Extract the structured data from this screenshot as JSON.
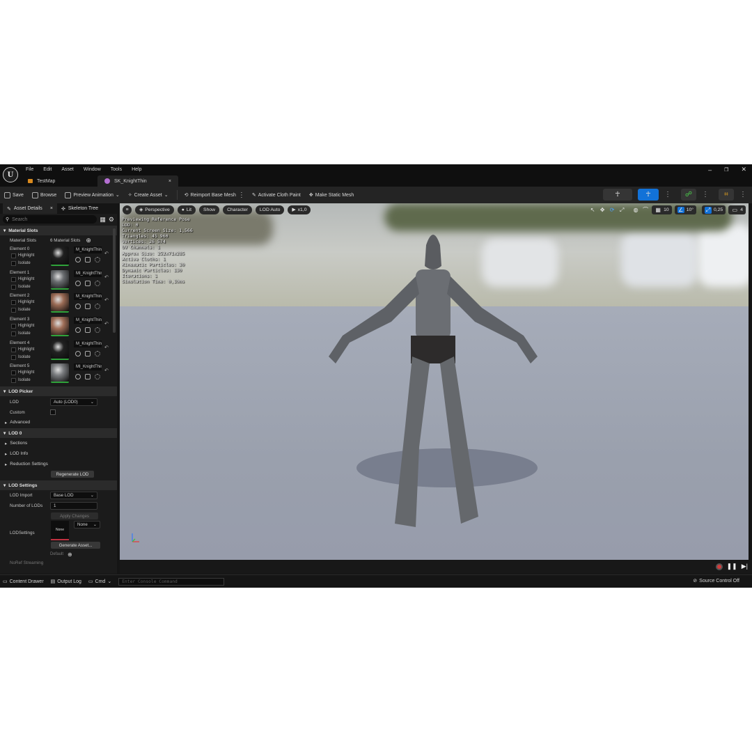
{
  "app": {
    "logo_letter": "U",
    "menu": [
      "File",
      "Edit",
      "Asset",
      "Window",
      "Tools",
      "Help"
    ],
    "tabs": [
      {
        "label": "TestMap",
        "active": false
      },
      {
        "label": "SK_KnightThin",
        "active": true
      }
    ],
    "window_controls": [
      "–",
      "❐",
      "✕"
    ]
  },
  "toolbar": {
    "save": "Save",
    "browse": "Browse",
    "preview_animation": "Preview Animation",
    "create_asset": "Create Asset",
    "reimport": "Reimport Base Mesh",
    "activate_cloth": "Activate Cloth Paint",
    "make_static": "Make Static Mesh"
  },
  "left_panel": {
    "tabs": [
      "Asset Details",
      "Skeleton Tree"
    ],
    "close_glyph": "×",
    "search_placeholder": "Search",
    "material_slots": {
      "header": "Material Slots",
      "label": "Material Slots",
      "count": "6 Material Slots",
      "highlight": "Highlight",
      "isolate": "Isolate",
      "elements": [
        {
          "name": "Element 0",
          "material": "M_KnightThin",
          "thumb": "#202020"
        },
        {
          "name": "Element 1",
          "material": "MI_KnightThin",
          "thumb": "#6a6d70"
        },
        {
          "name": "Element 2",
          "material": "M_KnightThin",
          "thumb": "#9a6b55"
        },
        {
          "name": "Element 3",
          "material": "M_KnightThin",
          "thumb": "#a06e58"
        },
        {
          "name": "Element 4",
          "material": "M_KnightThin",
          "thumb": "#222222"
        },
        {
          "name": "Element 5",
          "material": "MI_KnightThin",
          "thumb": "#7a7c7f"
        }
      ]
    },
    "lod_picker": {
      "header": "LOD Picker",
      "lod_label": "LOD",
      "lod_value": "Auto (LOD0)",
      "custom_label": "Custom",
      "advanced": "Advanced"
    },
    "lod0": {
      "header": "LOD 0",
      "sections": "Sections",
      "lod_info": "LOD Info",
      "reduction": "Reduction Settings",
      "regenerate": "Regenerate LOD"
    },
    "lod_settings": {
      "header": "LOD Settings",
      "import_label": "LOD Import",
      "import_value": "Base LOD",
      "num_label": "Number of LODs",
      "num_value": "1",
      "apply": "Apply Changes",
      "lodsettings_label": "LODSettings",
      "thumb_label": "None",
      "none_value": "None",
      "generate": "Generate Asset...",
      "default": "Default",
      "noref": "NoRef Streaming"
    }
  },
  "viewport": {
    "menu_icon": "≡",
    "perspective": "Perspective",
    "lit": "Lit",
    "show": "Show",
    "character": "Character",
    "lod_auto": "LOD Auto",
    "speed": "x1,0",
    "grid_value": "10",
    "angle_value": "10°",
    "scale_value": "0,25",
    "cam_value": "4",
    "stats": [
      "Previewing Reference Pose",
      "LOD: 0",
      "Current Screen Size: 1,566",
      "Triangles: 45 960",
      "Vertices: 26 574",
      "UV Channels: 1",
      "Approx Size: 252x71x285",
      "Active Cloths: 1",
      "Kinematic Particles: 30",
      "Dynamic Particles: 130",
      "Iterations: 1",
      "Simulation Time: 0,10ms"
    ]
  },
  "statusbar": {
    "content_drawer": "Content Drawer",
    "output_log": "Output Log",
    "cmd": "Cmd",
    "console_placeholder": "Enter Console Command",
    "source_control": "Source Control Off"
  }
}
